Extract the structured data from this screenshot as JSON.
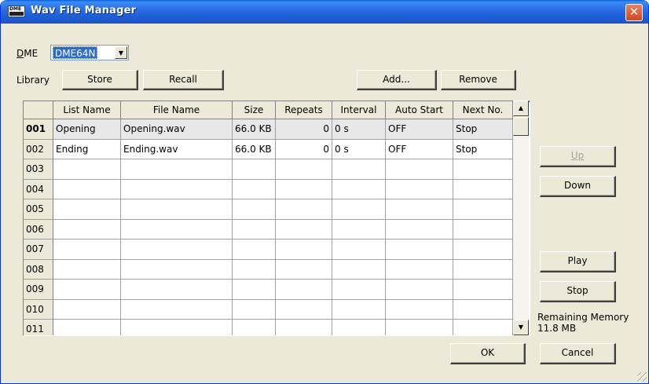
{
  "window": {
    "title": "Wav File Manager",
    "icon_text": "DME",
    "close_glyph": "✕"
  },
  "dme": {
    "label": "DME",
    "selected": "DME64N",
    "arrow": "▼"
  },
  "library": {
    "label": "Library",
    "store": "Store",
    "recall": "Recall",
    "add": "Add...",
    "remove": "Remove"
  },
  "table": {
    "columns": [
      "List Name",
      "File Name",
      "Size",
      "Repeats",
      "Interval",
      "Auto Start",
      "Next No."
    ],
    "rows": [
      {
        "no": "001",
        "list_name": "Opening",
        "file_name": "Opening.wav",
        "size": "66.0 KB",
        "repeats": "0",
        "interval": "0 s",
        "auto_start": "OFF",
        "next_no": "Stop"
      },
      {
        "no": "002",
        "list_name": "Ending",
        "file_name": "Ending.wav",
        "size": "66.0 KB",
        "repeats": "0",
        "interval": "0 s",
        "auto_start": "OFF",
        "next_no": "Stop"
      },
      {
        "no": "003",
        "list_name": "",
        "file_name": "",
        "size": "",
        "repeats": "",
        "interval": "",
        "auto_start": "",
        "next_no": ""
      },
      {
        "no": "004",
        "list_name": "",
        "file_name": "",
        "size": "",
        "repeats": "",
        "interval": "",
        "auto_start": "",
        "next_no": ""
      },
      {
        "no": "005",
        "list_name": "",
        "file_name": "",
        "size": "",
        "repeats": "",
        "interval": "",
        "auto_start": "",
        "next_no": ""
      },
      {
        "no": "006",
        "list_name": "",
        "file_name": "",
        "size": "",
        "repeats": "",
        "interval": "",
        "auto_start": "",
        "next_no": ""
      },
      {
        "no": "007",
        "list_name": "",
        "file_name": "",
        "size": "",
        "repeats": "",
        "interval": "",
        "auto_start": "",
        "next_no": ""
      },
      {
        "no": "008",
        "list_name": "",
        "file_name": "",
        "size": "",
        "repeats": "",
        "interval": "",
        "auto_start": "",
        "next_no": ""
      },
      {
        "no": "009",
        "list_name": "",
        "file_name": "",
        "size": "",
        "repeats": "",
        "interval": "",
        "auto_start": "",
        "next_no": ""
      },
      {
        "no": "010",
        "list_name": "",
        "file_name": "",
        "size": "",
        "repeats": "",
        "interval": "",
        "auto_start": "",
        "next_no": ""
      },
      {
        "no": "011",
        "list_name": "",
        "file_name": "",
        "size": "",
        "repeats": "",
        "interval": "",
        "auto_start": "",
        "next_no": ""
      }
    ],
    "scroll_up": "▲",
    "scroll_down": "▼"
  },
  "side": {
    "up": "Up",
    "down": "Down",
    "play": "Play",
    "stop": "Stop",
    "memory_label": "Remaining Memory",
    "memory_value": "11.8 MB"
  },
  "footer": {
    "ok": "OK",
    "cancel": "Cancel"
  }
}
